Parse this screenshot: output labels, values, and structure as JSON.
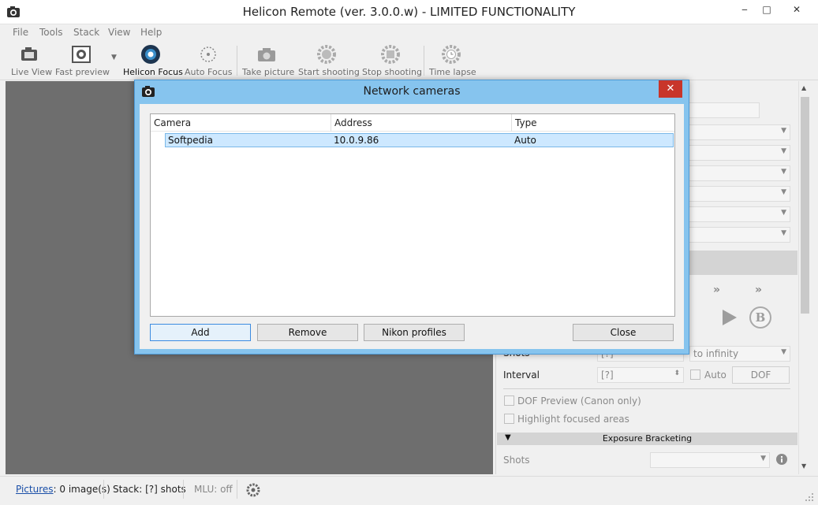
{
  "window": {
    "title": "Helicon Remote (ver. 3.0.0.w) - LIMITED FUNCTIONALITY",
    "minimize": "‒",
    "maximize": "□",
    "close": "✕"
  },
  "menu": [
    "File",
    "Tools",
    "Stack",
    "View",
    "Help"
  ],
  "toolbar": {
    "live_view": "Live View",
    "fast_preview": "Fast preview",
    "helicon_focus": "Helicon Focus",
    "auto_focus": "Auto Focus",
    "take_picture": "Take picture",
    "start_shooting": "Start shooting",
    "stop_shooting": "Stop shooting",
    "time_lapse": "Time lapse"
  },
  "dialog": {
    "title": "Network cameras",
    "close": "✕",
    "columns": [
      "Camera",
      "Address",
      "Type"
    ],
    "rows": [
      {
        "camera": "Softpedia",
        "address": "10.0.9.86",
        "type": "Auto"
      }
    ],
    "buttons": {
      "add": "Add",
      "remove": "Remove",
      "nikon_profiles": "Nikon profiles",
      "close": "Close"
    }
  },
  "right_panel": {
    "shots_label": "Shots",
    "shots_value": "[?]",
    "to_infinity": "to infinity",
    "interval_label": "Interval",
    "interval_value": "[?]",
    "auto_label": "Auto",
    "dof_button": "DOF",
    "dof_preview": "DOF Preview (Canon only)",
    "highlight_focused": "Highlight focused areas",
    "exposure_bracketing": "Exposure Bracketing",
    "eb_shots_label": "Shots"
  },
  "statusbar": {
    "pictures_link": "Pictures",
    "pictures_count": ": 0 image(s)",
    "stack": "Stack: [?] shots",
    "mlu": "MLU: off"
  },
  "colors": {
    "accent": "#86c4ee",
    "viewer_bg": "#6e6e6e",
    "close_red": "#c8352a",
    "selection": "#cde8ff"
  }
}
